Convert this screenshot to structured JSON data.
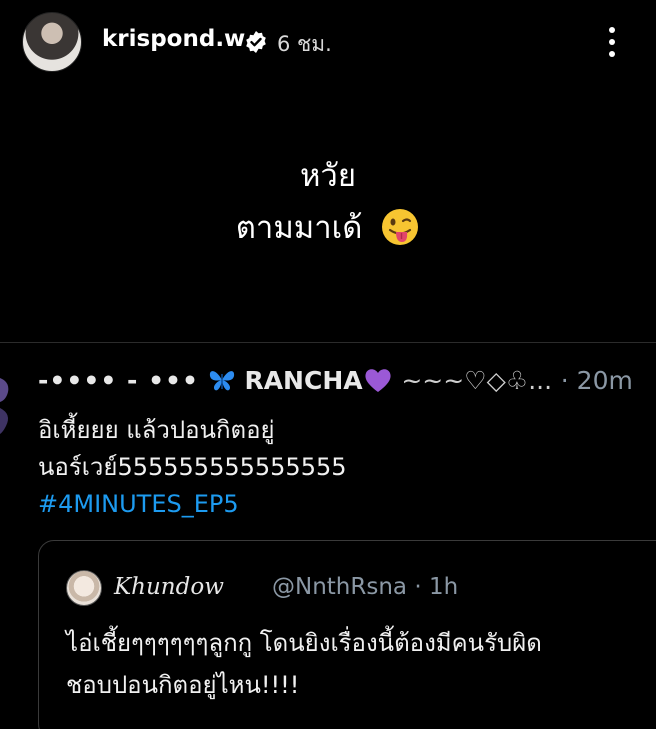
{
  "story": {
    "username": "krispond.w",
    "time": "6 ชม.",
    "caption": [
      "หวัย",
      "ตามมาเด้"
    ]
  },
  "tweet": {
    "prefix": "-•••• - •••",
    "name": "RANCHA",
    "suffix": "~~~♡◇♧...",
    "time": "· 20m",
    "body_lines": [
      "อิเหี้ยยย แล้วปอนกิตอยู่",
      "นอร์เวย์555555555555555"
    ],
    "hashtag": "#4MINUTES_EP5"
  },
  "quote": {
    "name": "Khundow",
    "handle": "@NnthRsna · 1h",
    "body_lines": [
      "ไอ่เชี้ยๆๆๆๆๆๆลูกกู โดนยิงเรื่องนี้ต้องมีคนรับผิด",
      "ชอบปอนกิตอยู่ไหน!!!!"
    ]
  },
  "colors": {
    "background": "#000000",
    "hashtag": "#1d9bf0",
    "muted": "#8b98a5",
    "heart": "#9b59d6",
    "butterfly": "#2d8cf0"
  },
  "icons": {
    "verified": "verified-badge-icon",
    "more": "more-options-icon",
    "emoji": "tongue-face-emoji",
    "butterfly": "butterfly-icon",
    "heart": "purple-heart-icon"
  }
}
